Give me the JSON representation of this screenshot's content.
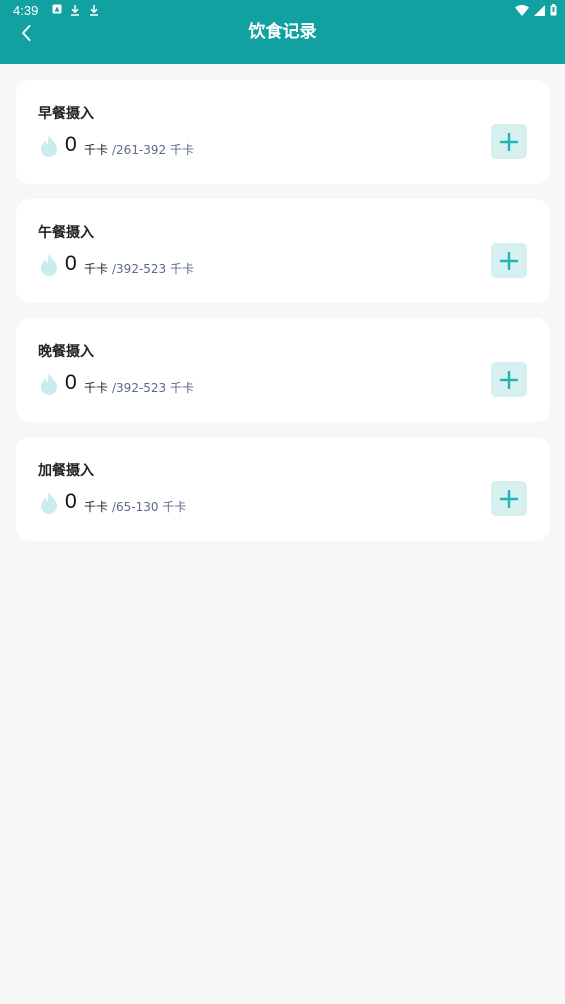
{
  "status_bar": {
    "time": "4:39",
    "left_icons": [
      "app-notification-icon",
      "download-icon",
      "download-icon"
    ],
    "right_icons": [
      "wifi-icon",
      "signal-icon",
      "battery-icon"
    ]
  },
  "header": {
    "title": "饮食记录",
    "back_icon": "chevron-left-icon",
    "background_color": "#11a1a1"
  },
  "meals": [
    {
      "title": "早餐摄入",
      "value": "0",
      "unit": "千卡",
      "range": "/261-392 千卡"
    },
    {
      "title": "午餐摄入",
      "value": "0",
      "unit": "千卡",
      "range": "/392-523 千卡"
    },
    {
      "title": "晚餐摄入",
      "value": "0",
      "unit": "千卡",
      "range": "/392-523 千卡"
    },
    {
      "title": "加餐摄入",
      "value": "0",
      "unit": "千卡",
      "range": "/65-130 千卡"
    }
  ],
  "colors": {
    "accent": "#11a1a1",
    "add_button_bg": "#d6f0f0",
    "add_button_icon": "#1fb3b3",
    "flame": "#c9ecef",
    "range_text": "#5a6a8a"
  }
}
